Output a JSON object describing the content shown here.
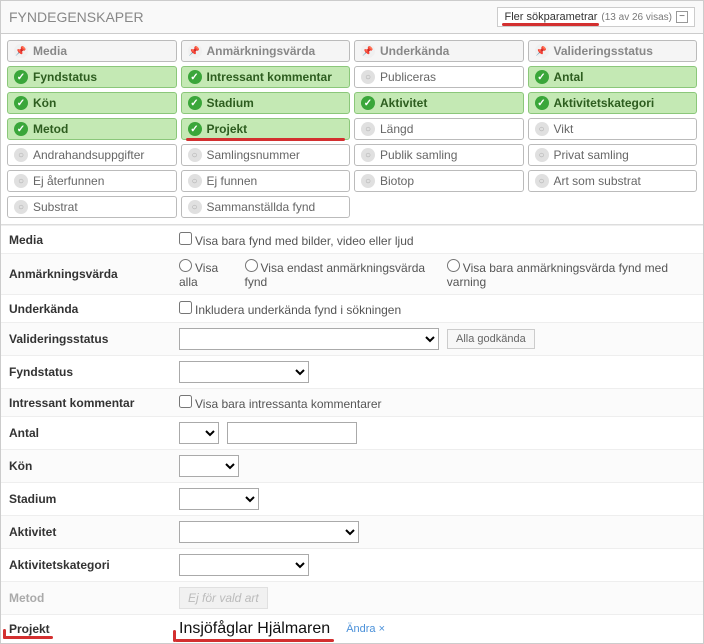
{
  "header": {
    "title": "FYNDEGENSKAPER",
    "more_params_label": "Fler sökparametrar",
    "more_params_count": "(13 av 26 visas)"
  },
  "category_headers": [
    "Media",
    "Anmärkningsvärda",
    "Underkända",
    "Valideringsstatus"
  ],
  "chips": [
    [
      {
        "label": "Fyndstatus",
        "state": "active"
      },
      {
        "label": "Intressant kommentar",
        "state": "active"
      },
      {
        "label": "Publiceras",
        "state": "inactive"
      },
      {
        "label": "Antal",
        "state": "active"
      }
    ],
    [
      {
        "label": "Kön",
        "state": "active"
      },
      {
        "label": "Stadium",
        "state": "active"
      },
      {
        "label": "Aktivitet",
        "state": "active"
      },
      {
        "label": "Aktivitetskategori",
        "state": "active"
      }
    ],
    [
      {
        "label": "Metod",
        "state": "active"
      },
      {
        "label": "Projekt",
        "state": "active",
        "underline": true
      },
      {
        "label": "Längd",
        "state": "inactive"
      },
      {
        "label": "Vikt",
        "state": "inactive"
      }
    ],
    [
      {
        "label": "Andrahandsuppgifter",
        "state": "inactive"
      },
      {
        "label": "Samlingsnummer",
        "state": "inactive"
      },
      {
        "label": "Publik samling",
        "state": "inactive"
      },
      {
        "label": "Privat samling",
        "state": "inactive"
      }
    ],
    [
      {
        "label": "Ej återfunnen",
        "state": "inactive"
      },
      {
        "label": "Ej funnen",
        "state": "inactive"
      },
      {
        "label": "Biotop",
        "state": "inactive"
      },
      {
        "label": "Art som substrat",
        "state": "inactive"
      }
    ],
    [
      {
        "label": "Substrat",
        "state": "inactive"
      },
      {
        "label": "Sammanställda fynd",
        "state": "inactive"
      },
      {
        "label": "",
        "state": "empty"
      },
      {
        "label": "",
        "state": "empty"
      }
    ]
  ],
  "rows": {
    "media_label": "Media",
    "media_text": "Visa bara fynd med bilder, video eller ljud",
    "anm_label": "Anmärkningsvärda",
    "anm_opt1": "Visa alla",
    "anm_opt2": "Visa endast anmärkningsvärda fynd",
    "anm_opt3": "Visa bara anmärkningsvärda fynd med varning",
    "under_label": "Underkända",
    "under_text": "Inkludera underkända fynd i sökningen",
    "valid_label": "Valideringsstatus",
    "valid_btn": "Alla godkända",
    "fynd_label": "Fyndstatus",
    "intr_label": "Intressant kommentar",
    "intr_text": "Visa bara intressanta kommentarer",
    "antal_label": "Antal",
    "kon_label": "Kön",
    "stadium_label": "Stadium",
    "aktivitet_label": "Aktivitet",
    "aktkat_label": "Aktivitetskategori",
    "metod_label": "Metod",
    "metod_text": "Ej för vald art",
    "projekt_label": "Projekt",
    "projekt_value": "Insjöfåglar Hjälmaren",
    "projekt_change": "Ändra ×"
  }
}
